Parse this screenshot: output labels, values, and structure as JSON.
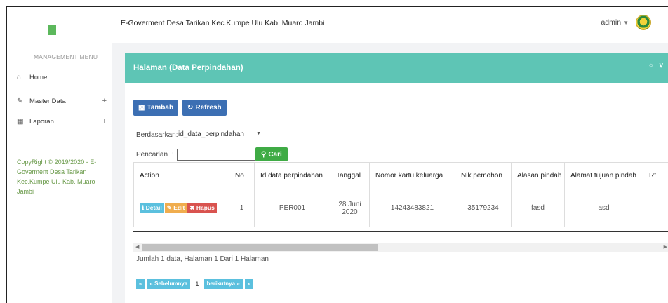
{
  "header": {
    "app_title": "E-Goverment Desa Tarikan Kec.Kumpe Ulu Kab. Muaro Jambi",
    "user_name": "admin"
  },
  "sidebar": {
    "menu_title": "MANAGEMENT MENU",
    "items": [
      {
        "label": "Home",
        "icon": "home-icon"
      },
      {
        "label": "Master Data",
        "icon": "edit-icon",
        "expand": "+"
      },
      {
        "label": "Laporan",
        "icon": "calendar-icon",
        "expand": "+"
      }
    ],
    "copyright": "CopyRight © 2019/2020 - E-Goverment Desa Tarikan Kec.Kumpe Ulu Kab. Muaro Jambi"
  },
  "panel": {
    "title": "Halaman (Data Perpindahan)",
    "buttons": {
      "tambah": "Tambah",
      "refresh": "Refresh",
      "cari": "Cari"
    },
    "berdasarkan_label": "Berdasarkan:",
    "berdasarkan_value": "id_data_perpindahan",
    "pencarian_label": "Pencarian",
    "pencarian_sep": ":",
    "pencarian_value": ""
  },
  "table": {
    "headers": [
      "Action",
      "No",
      "Id data perpindahan",
      "Tanggal",
      "Nomor kartu keluarga",
      "Nik pemohon",
      "Alasan pindah",
      "Alamat tujuan pindah",
      "Rt"
    ],
    "rows": [
      {
        "no": "1",
        "id": "PER001",
        "tanggal": "28 Juni 2020",
        "kk": "14243483821",
        "nik": "35179234",
        "alasan": "fasd",
        "alamat": "asd",
        "rt": ""
      }
    ],
    "row_actions": {
      "detail": "Detail",
      "edit": "Edit",
      "hapus": "Hapus"
    }
  },
  "footer": {
    "info": "Jumlah 1 data, Halaman 1 Dari 1 Halaman",
    "pager": {
      "first": "«",
      "prev": "« Sebelumnya",
      "page": "1",
      "next": "berikutnya »",
      "last": "»"
    }
  },
  "colors": {
    "panel_header": "#5ec5b5",
    "primary_button": "#3c6fb3",
    "search_button": "#3fab45",
    "detail": "#5bc0de",
    "edit": "#f0ad4e",
    "hapus": "#d9534f"
  }
}
